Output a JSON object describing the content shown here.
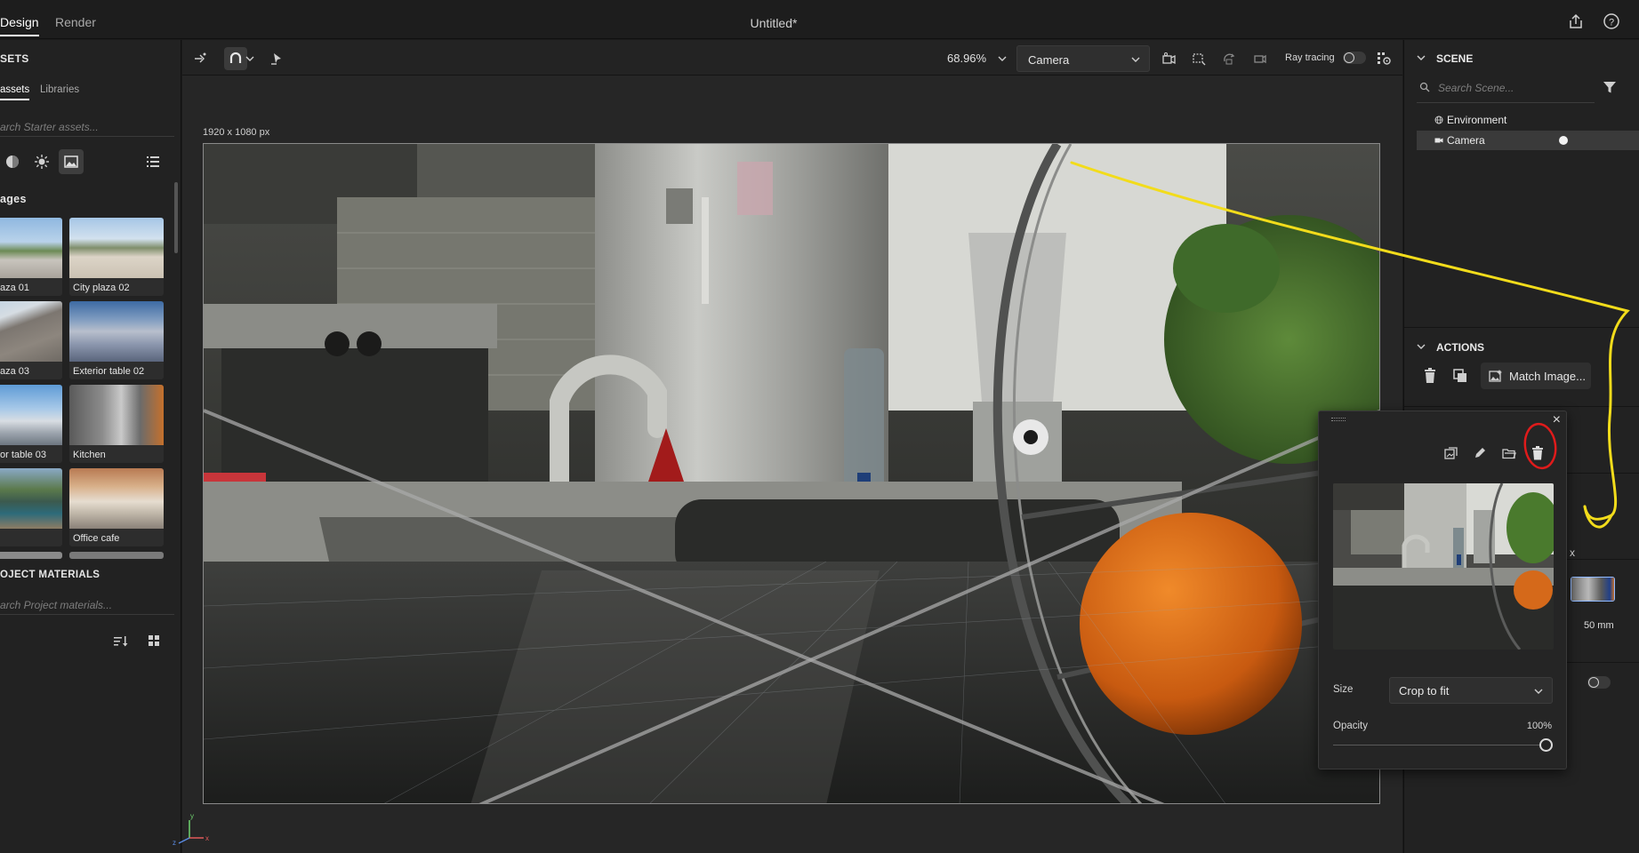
{
  "topbar": {
    "tabs": [
      {
        "label": "Design",
        "active": true
      },
      {
        "label": "Render",
        "active": false
      }
    ],
    "title": "Untitled*",
    "icons": [
      "share-icon",
      "help-icon"
    ]
  },
  "assets_panel": {
    "header": "SETS",
    "subtabs": [
      {
        "label": "assets",
        "active": true
      },
      {
        "label": "Libraries",
        "active": false
      }
    ],
    "search_placeholder": "arch Starter assets...",
    "filter_icons": [
      "material-sphere-icon",
      "light-sun-icon",
      "image-icon",
      "list-view-icon"
    ],
    "section": "ages",
    "thumbnails": [
      {
        "label": "aza 01"
      },
      {
        "label": "City plaza 02"
      },
      {
        "label": "aza 03"
      },
      {
        "label": "Exterior table 02"
      },
      {
        "label": "or table 03"
      },
      {
        "label": "Kitchen"
      },
      {
        "label": ""
      },
      {
        "label": "Office cafe"
      }
    ],
    "materials_header": "OJECT MATERIALS",
    "materials_search": "arch Project materials..."
  },
  "toolbar": {
    "zoom": "68.96%",
    "camera_select": "Camera",
    "ray_tracing_label": "Ray tracing",
    "ray_tracing_on": false
  },
  "viewport": {
    "resolution": "1920 x 1080 px",
    "axis_labels": {
      "x": "x",
      "y": "y",
      "z": "z"
    }
  },
  "scene_panel": {
    "header": "SCENE",
    "search_placeholder": "Search Scene...",
    "items": [
      {
        "label": "Environment",
        "selected": false
      },
      {
        "label": "Camera",
        "selected": true
      }
    ]
  },
  "actions_panel": {
    "header": "ACTIONS",
    "match_image_label": "Match Image...",
    "partial_x": "x",
    "focal_length": "50 mm"
  },
  "background_popover": {
    "size_label": "Size",
    "size_value": "Crop to fit",
    "opacity_label": "Opacity",
    "opacity_value": "100%",
    "opacity_fraction": 1.0
  },
  "colors": {
    "accent_blue": "#8fb9ff",
    "annotation_yellow": "#f2dc1b",
    "annotation_red": "#e01b1b"
  }
}
